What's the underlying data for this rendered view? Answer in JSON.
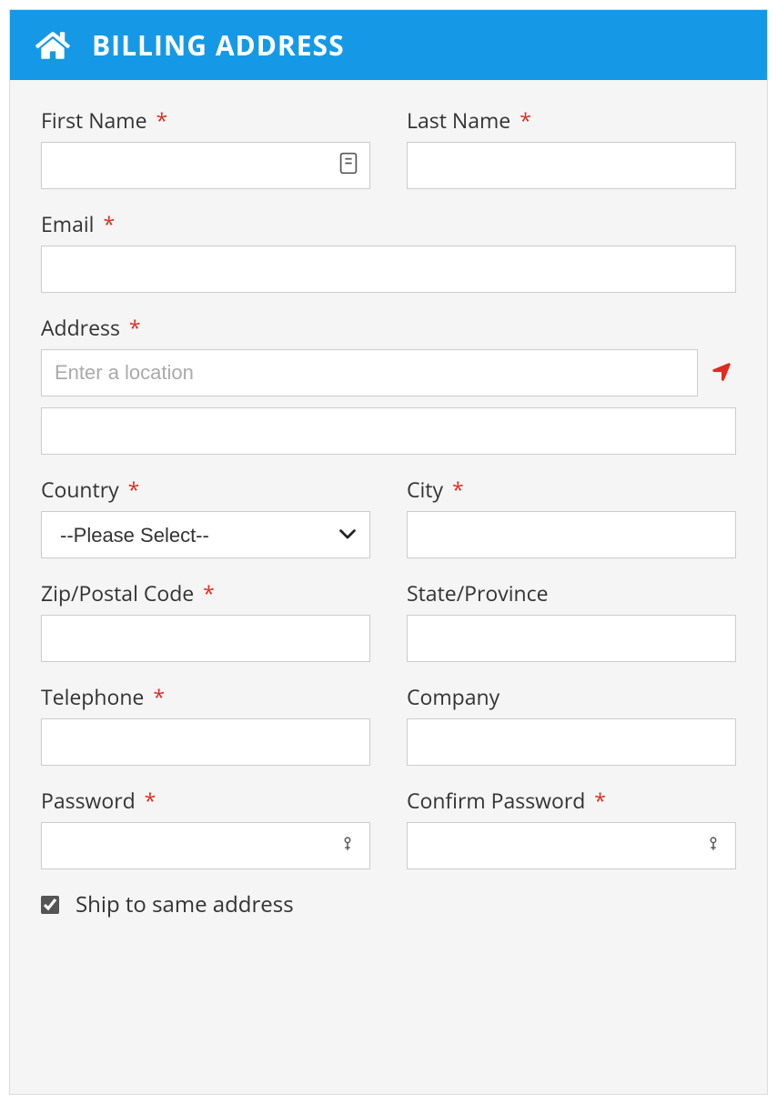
{
  "header": {
    "title": "BILLING ADDRESS"
  },
  "labels": {
    "first_name": "First Name",
    "last_name": "Last Name",
    "email": "Email",
    "address": "Address",
    "country": "Country",
    "city": "City",
    "zip": "Zip/Postal Code",
    "state": "State/Province",
    "telephone": "Telephone",
    "company": "Company",
    "password": "Password",
    "confirm_password": "Confirm Password",
    "ship_same": "Ship to same address"
  },
  "required_marker": "*",
  "values": {
    "first_name": "",
    "last_name": "",
    "email": "",
    "address1": "",
    "address2": "",
    "country": "--Please Select--",
    "city": "",
    "zip": "",
    "state": "",
    "telephone": "",
    "company": "",
    "password": "",
    "confirm_password": ""
  },
  "placeholders": {
    "address1": "Enter a location"
  },
  "country_options": [
    "--Please Select--"
  ],
  "ship_same_checked": true
}
